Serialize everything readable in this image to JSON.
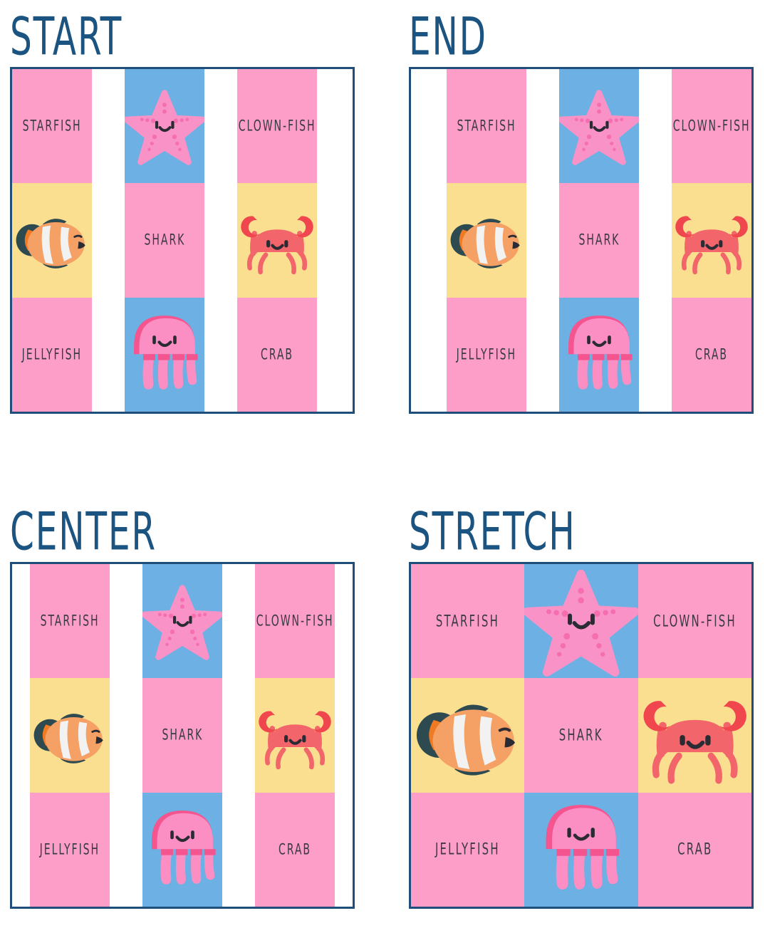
{
  "panels": [
    {
      "title": "START",
      "alignment": "start",
      "columns": [
        {
          "cells": [
            {
              "label": "STARFISH",
              "bg": "#fc9ec8",
              "art": null
            },
            {
              "label": null,
              "bg": "#fbdf91",
              "art": "clownfish-icon"
            },
            {
              "label": "JELLYFISH",
              "bg": "#fc9ec8",
              "art": null
            }
          ]
        },
        {
          "cells": [
            {
              "label": null,
              "bg": "#6db0e4",
              "art": "starfish-icon"
            },
            {
              "label": "SHARK",
              "bg": "#fc9ec8",
              "art": null
            },
            {
              "label": null,
              "bg": "#6db0e4",
              "art": "jellyfish-icon"
            }
          ]
        },
        {
          "cells": [
            {
              "label": "CLOWN-FISH",
              "bg": "#fc9ec8",
              "art": null
            },
            {
              "label": null,
              "bg": "#fbdf91",
              "art": "crab-icon"
            },
            {
              "label": "CRAB",
              "bg": "#fc9ec8",
              "art": null
            }
          ]
        }
      ]
    },
    {
      "title": "END",
      "alignment": "end",
      "columns": [
        {
          "cells": [
            {
              "label": "STARFISH",
              "bg": "#fc9ec8",
              "art": null
            },
            {
              "label": null,
              "bg": "#fbdf91",
              "art": "clownfish-icon"
            },
            {
              "label": "JELLYFISH",
              "bg": "#fc9ec8",
              "art": null
            }
          ]
        },
        {
          "cells": [
            {
              "label": null,
              "bg": "#6db0e4",
              "art": "starfish-icon"
            },
            {
              "label": "SHARK",
              "bg": "#fc9ec8",
              "art": null
            },
            {
              "label": null,
              "bg": "#6db0e4",
              "art": "jellyfish-icon"
            }
          ]
        },
        {
          "cells": [
            {
              "label": "CLOWN-FISH",
              "bg": "#fc9ec8",
              "art": null
            },
            {
              "label": null,
              "bg": "#fbdf91",
              "art": "crab-icon"
            },
            {
              "label": "CRAB",
              "bg": "#fc9ec8",
              "art": null
            }
          ]
        }
      ]
    },
    {
      "title": "CENTER",
      "alignment": "center",
      "columns": [
        {
          "cells": [
            {
              "label": "STARFISH",
              "bg": "#fc9ec8",
              "art": null
            },
            {
              "label": null,
              "bg": "#fbdf91",
              "art": "clownfish-icon"
            },
            {
              "label": "JELLYFISH",
              "bg": "#fc9ec8",
              "art": null
            }
          ]
        },
        {
          "cells": [
            {
              "label": null,
              "bg": "#6db0e4",
              "art": "starfish-icon"
            },
            {
              "label": "SHARK",
              "bg": "#fc9ec8",
              "art": null
            },
            {
              "label": null,
              "bg": "#6db0e4",
              "art": "jellyfish-icon"
            }
          ]
        },
        {
          "cells": [
            {
              "label": "CLOWN-FISH",
              "bg": "#fc9ec8",
              "art": null
            },
            {
              "label": null,
              "bg": "#fbdf91",
              "art": "crab-icon"
            },
            {
              "label": "CRAB",
              "bg": "#fc9ec8",
              "art": null
            }
          ]
        }
      ]
    },
    {
      "title": "STRETCH",
      "alignment": "stretch",
      "columns": [
        {
          "cells": [
            {
              "label": "STARFISH",
              "bg": "#fc9ec8",
              "art": null
            },
            {
              "label": null,
              "bg": "#fbdf91",
              "art": "clownfish-icon"
            },
            {
              "label": "JELLYFISH",
              "bg": "#fc9ec8",
              "art": null
            }
          ]
        },
        {
          "cells": [
            {
              "label": null,
              "bg": "#6db0e4",
              "art": "starfish-icon"
            },
            {
              "label": "SHARK",
              "bg": "#fc9ec8",
              "art": null
            },
            {
              "label": null,
              "bg": "#6db0e4",
              "art": "jellyfish-icon"
            }
          ]
        },
        {
          "cells": [
            {
              "label": "CLOWN-FISH",
              "bg": "#fc9ec8",
              "art": null
            },
            {
              "label": null,
              "bg": "#fbdf91",
              "art": "crab-icon"
            },
            {
              "label": "CRAB",
              "bg": "#fc9ec8",
              "art": null
            }
          ]
        }
      ]
    }
  ],
  "colors": {
    "title": "#1b5480",
    "border": "#1e4e79",
    "label": "#3a3a42",
    "pink": "#fc9ec8",
    "blue": "#6db0e4",
    "yellow": "#fbdf91",
    "background": "#ffffff",
    "starfish_body": "#f993c7",
    "starfish_dots": "#f56eb0",
    "jellyfish_body": "#fb8fc4",
    "jellyfish_shade": "#f4558f",
    "crab_body": "#f2656a",
    "crab_claw": "#f0474f",
    "clownfish_body": "#f5a064",
    "clownfish_stripe": "#f2f2f2",
    "clownfish_fin": "#2d4a50",
    "face": "#2b2b33"
  }
}
